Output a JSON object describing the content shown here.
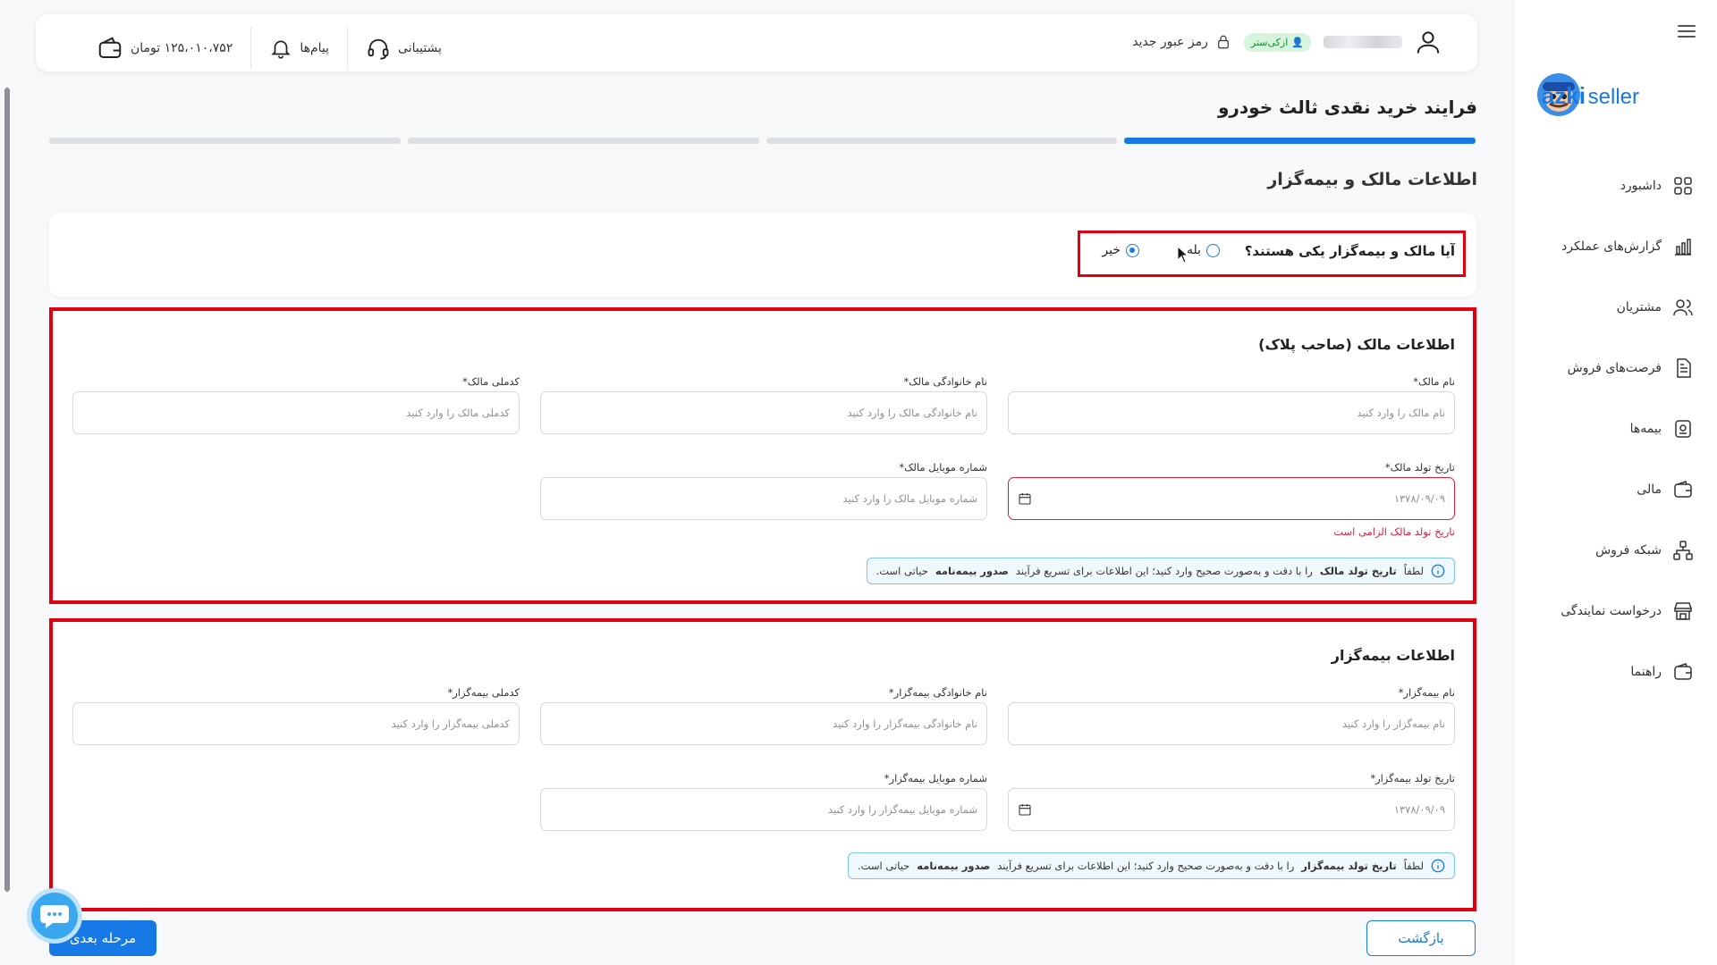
{
  "sidebar": {
    "logo_text": "azki seller",
    "items": [
      {
        "label": "داشبورد",
        "icon": "dashboard-icon"
      },
      {
        "label": "گزارش‌های عملکرد",
        "icon": "chart-icon"
      },
      {
        "label": "مشتریان",
        "icon": "users-icon"
      },
      {
        "label": "فرصت‌های فروش",
        "icon": "document-icon"
      },
      {
        "label": "بیمه‌ها",
        "icon": "shield-icon"
      },
      {
        "label": "مالی",
        "icon": "wallet-icon"
      },
      {
        "label": "شبکه فروش",
        "icon": "network-icon"
      },
      {
        "label": "درخواست نمایندگی",
        "icon": "store-icon"
      },
      {
        "label": "راهنما",
        "icon": "help-icon"
      }
    ]
  },
  "header": {
    "badge": "ازکی‌ستر",
    "change_password": "رمز عبور جدید",
    "balance": "۱۲۵،۰۱۰،۷۵۲ تومان",
    "messages": "پیام‌ها",
    "support": "پشتیبانی"
  },
  "page": {
    "title": "فرایند خرید نقدی ثالث خودرو",
    "section_title": "اطلاعات مالک و بیمه‌گزار",
    "steps_total": 4,
    "steps_active": 1
  },
  "question": {
    "label": "آیا مالک و بیمه‌گزار یکی هستند؟",
    "yes": "بله",
    "no": "خیر",
    "selected": "no"
  },
  "owner": {
    "title": "اطلاعات مالک (صاحب پلاک)",
    "first_name_label": "نام مالک*",
    "first_name_placeholder": "نام مالک را وارد کنید",
    "last_name_label": "نام خانوادگی مالک*",
    "last_name_placeholder": "نام خانوادگی مالک را وارد کنید",
    "national_id_label": "کدملی مالک*",
    "national_id_placeholder": "کدملی مالک را وارد کنید",
    "birth_label": "تاریخ تولد مالک*",
    "birth_placeholder": "۱۳۷۸/۰۹/۰۹",
    "birth_error": "تاریخ تولد مالک الزامی است",
    "mobile_label": "شماره موبایل مالک*",
    "mobile_placeholder": "شماره موبایل مالک را وارد کنید",
    "info_pre": "لطفاً",
    "info_bold1": "تاریخ تولد مالک",
    "info_mid": "را با دقت و به‌صورت صحیح وارد کنید؛ این اطلاعات برای تسریع فرآیند",
    "info_bold2": "صدور بیمه‌نامه",
    "info_post": "حیاتی است."
  },
  "insurer": {
    "title": "اطلاعات بیمه‌گزار",
    "first_name_label": "نام بیمه‌گزار*",
    "first_name_placeholder": "نام بیمه‌گزار را وارد کنید",
    "last_name_label": "نام خانوادگی بیمه‌گزار*",
    "last_name_placeholder": "نام خانوادگی بیمه‌گزار را وارد کنید",
    "national_id_label": "کدملی بیمه‌گزار*",
    "national_id_placeholder": "کدملی بیمه‌گزار را وارد کنید",
    "birth_label": "تاریخ تولد بیمه‌گزار*",
    "birth_placeholder": "۱۳۷۸/۰۹/۰۹",
    "mobile_label": "شماره موبایل بیمه‌گزار*",
    "mobile_placeholder": "شماره موبایل بیمه‌گزار را وارد کنید",
    "info_pre": "لطفاً",
    "info_bold1": "تاریخ تولد بیمه‌گزار",
    "info_mid": "را با دقت و به‌صورت صحیح وارد کنید؛ این اطلاعات برای تسریع فرآیند",
    "info_bold2": "صدور بیمه‌نامه",
    "info_post": "حیاتی است."
  },
  "footer": {
    "next": "مرحله بعدی",
    "back": "بازگشت"
  },
  "colors": {
    "primary": "#1779e6",
    "highlight": "#e00010",
    "error": "#d8203a"
  }
}
